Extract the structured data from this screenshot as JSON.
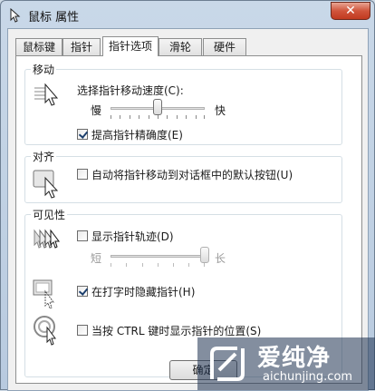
{
  "window": {
    "title": "鼠标 属性",
    "close_label": "✕"
  },
  "tabs": [
    {
      "label": "鼠标键"
    },
    {
      "label": "指针"
    },
    {
      "label": "指针选项"
    },
    {
      "label": "滑轮"
    },
    {
      "label": "硬件"
    }
  ],
  "motion": {
    "title": "移动",
    "speed_label": "选择指针移动速度(C):",
    "slow": "慢",
    "fast": "快",
    "speed_value_fraction": 0.5,
    "precision_label": "提高指针精确度(E)",
    "precision_checked": true
  },
  "snap": {
    "title": "对齐",
    "snap_label": "自动将指针移动到对话框中的默认按钮(U)",
    "snap_checked": false
  },
  "visibility": {
    "title": "可见性",
    "trails_label": "显示指针轨迹(D)",
    "trails_checked": false,
    "short": "短",
    "long": "长",
    "trails_value_fraction": 1.0,
    "hide_label": "在打字时隐藏指针(H)",
    "hide_checked": true,
    "ctrl_label": "当按 CTRL 键时显示指针的位置(S)",
    "ctrl_checked": false
  },
  "buttons": {
    "ok_label": "确定"
  },
  "watermark": {
    "cn": "爱纯净",
    "en": "aichunjing.com"
  },
  "colors": {
    "close_button": "#c1391f",
    "titlebar": "#c9d8e8",
    "check": "#1c3f6d"
  },
  "icons": {
    "app": "mouse-icon",
    "motion": "pointer-speed-icon",
    "snap": "snap-to-button-icon",
    "trails": "pointer-trails-icon",
    "hide": "hide-pointer-icon",
    "ctrl": "show-location-icon"
  }
}
